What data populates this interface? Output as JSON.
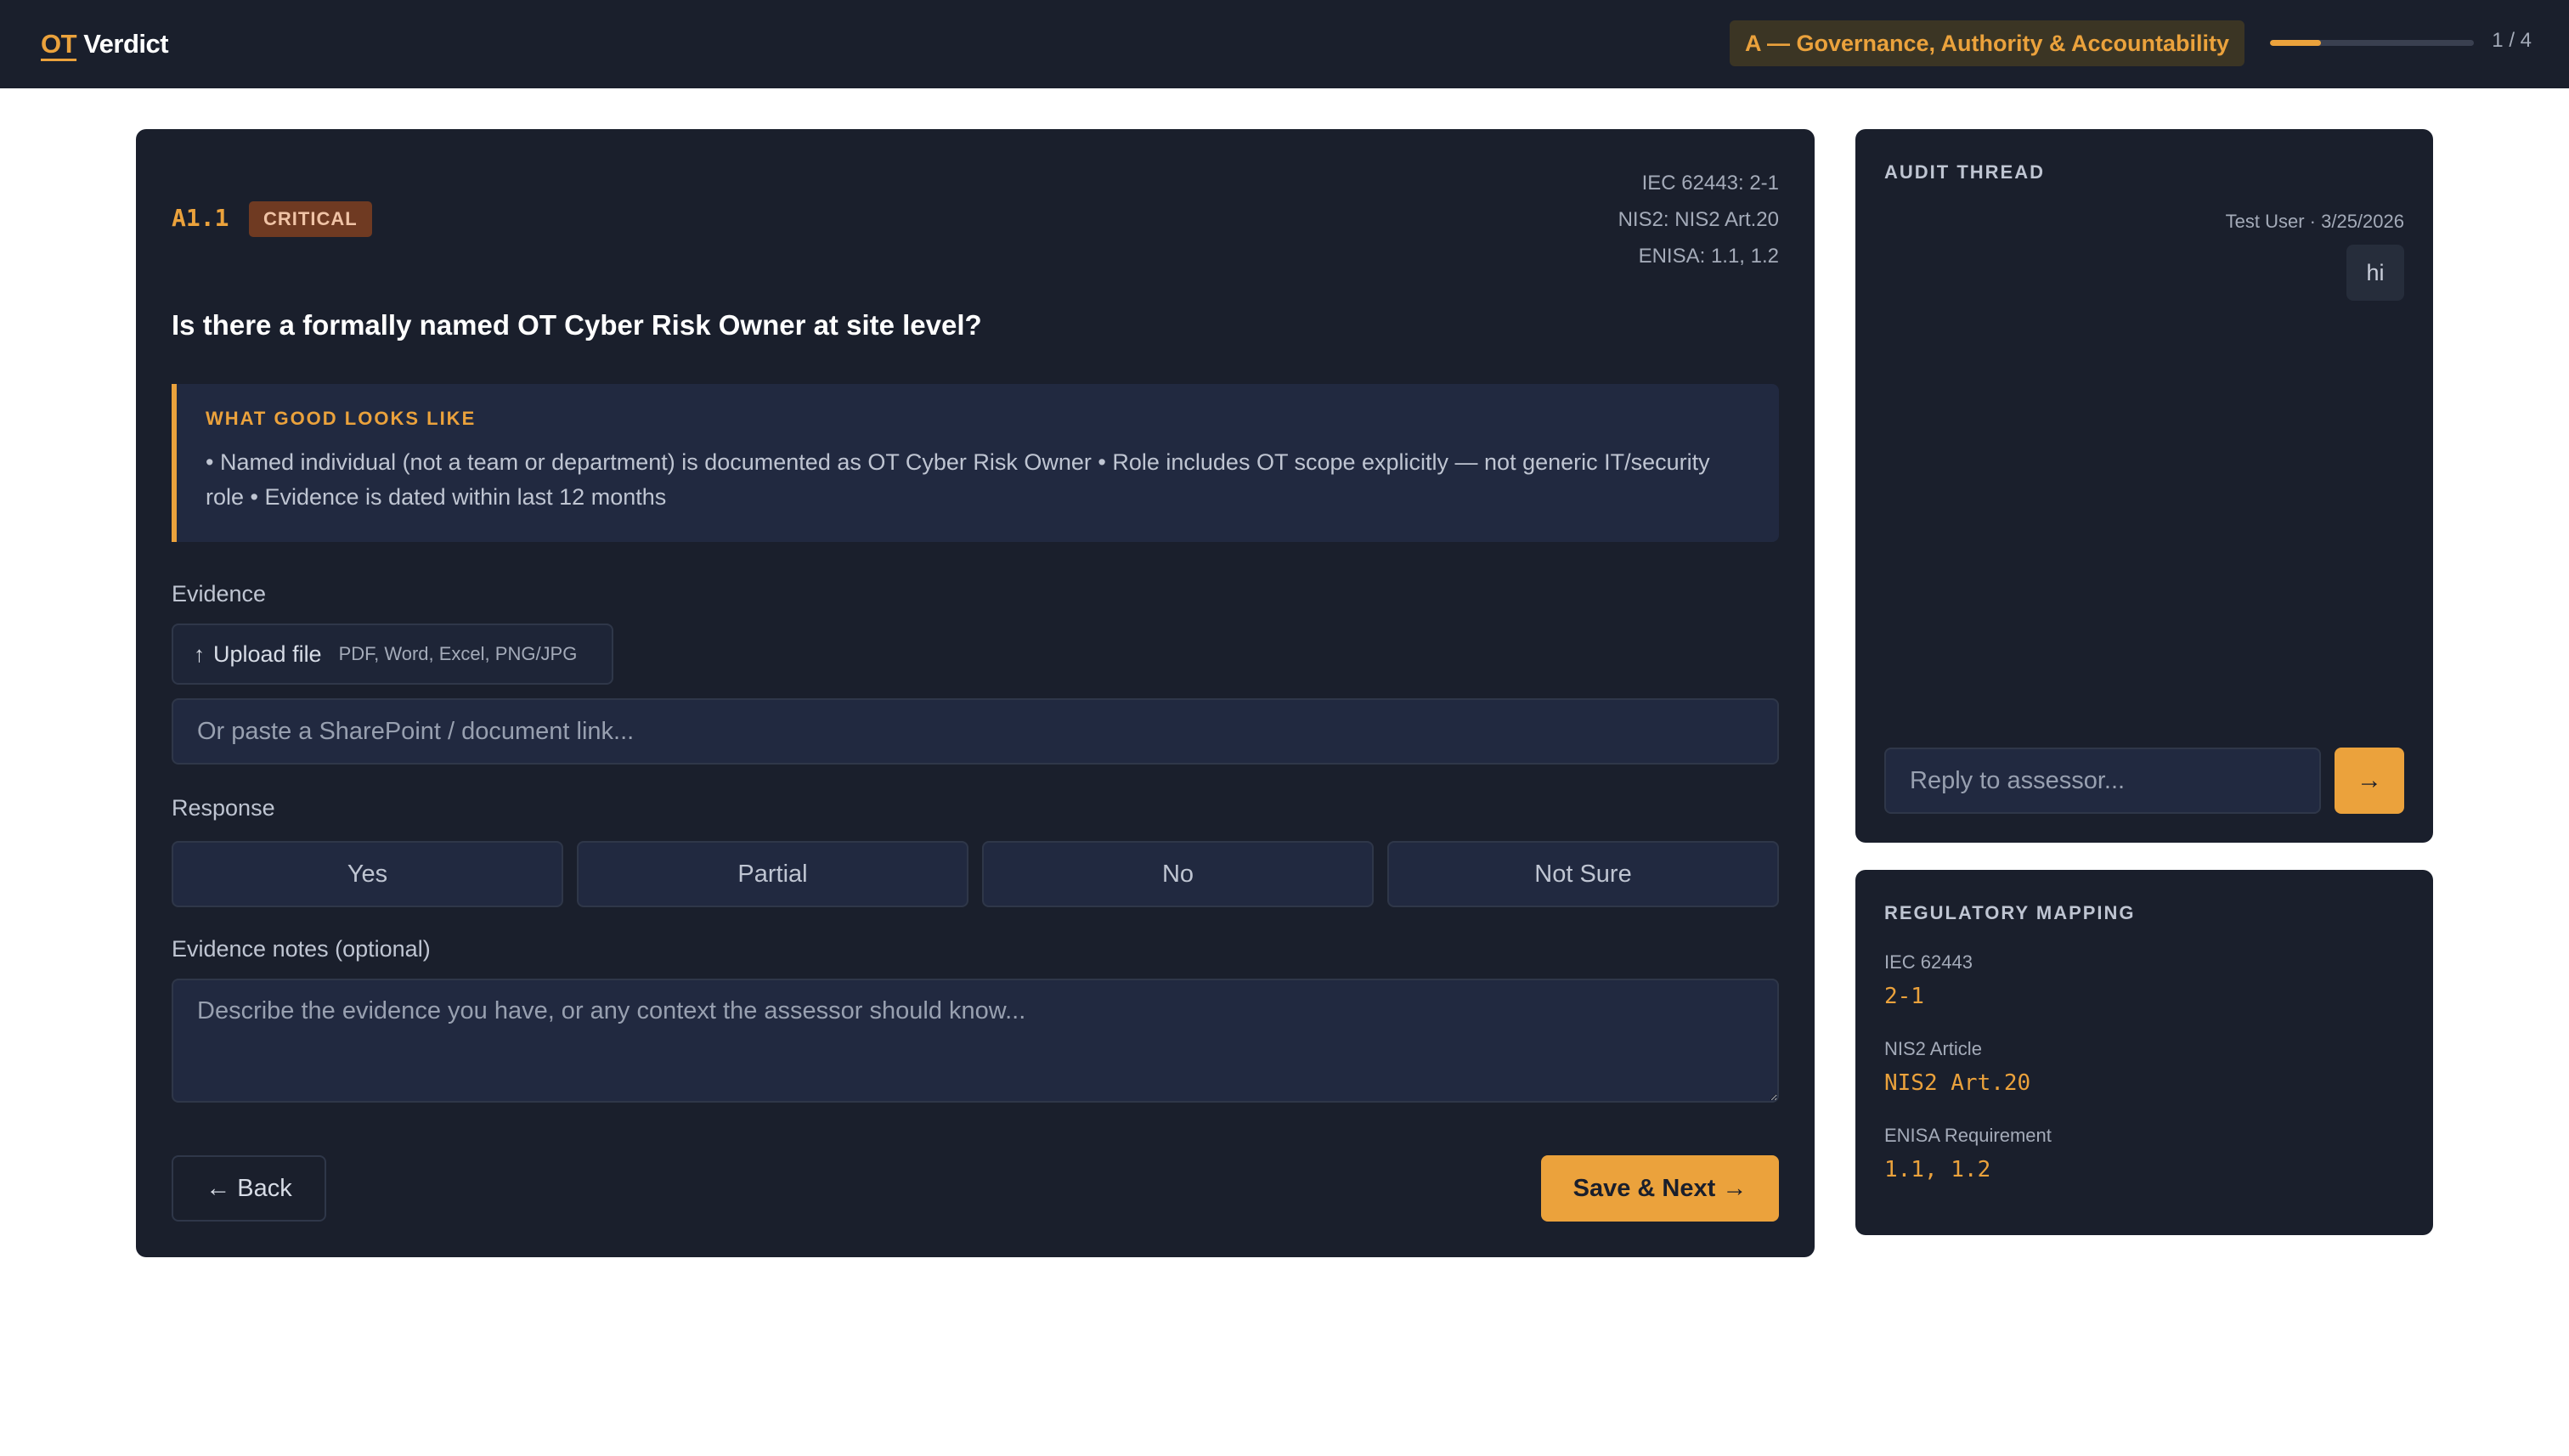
{
  "brand": {
    "accent": "OT",
    "name": "Verdict"
  },
  "header": {
    "section": "A — Governance, Authority & Accountability",
    "progress_fraction": 0.25,
    "progress_text": "1 / 4"
  },
  "question": {
    "id": "A1.1",
    "severity": "CRITICAL",
    "refs": [
      "IEC 62443: 2-1",
      "NIS2: NIS2 Art.20",
      "ENISA: 1.1, 1.2"
    ],
    "text": "Is there a formally named OT Cyber Risk Owner at site level?",
    "good": {
      "title": "WHAT GOOD LOOKS LIKE",
      "body": "• Named individual (not a team or department) is documented as OT Cyber Risk Owner • Role includes OT scope explicitly — not generic IT/security role • Evidence is dated within last 12 months"
    }
  },
  "evidence": {
    "label": "Evidence",
    "upload_label": "Upload file",
    "upload_hint": "PDF, Word, Excel, PNG/JPG",
    "link_placeholder": "Or paste a SharePoint / document link..."
  },
  "response": {
    "label": "Response",
    "options": [
      "Yes",
      "Partial",
      "No",
      "Not Sure"
    ]
  },
  "notes": {
    "label": "Evidence notes (optional)",
    "placeholder": "Describe the evidence you have, or any context the assessor should know..."
  },
  "actions": {
    "back": "← Back",
    "save": "Save & Next →"
  },
  "audit": {
    "title": "AUDIT THREAD",
    "messages": [
      {
        "meta": "Test User · 3/25/2026",
        "text": "hi"
      }
    ],
    "reply_placeholder": "Reply to assessor...",
    "send": "→"
  },
  "regulatory": {
    "title": "REGULATORY MAPPING",
    "items": [
      {
        "label": "IEC 62443",
        "value": "2-1"
      },
      {
        "label": "NIS2 Article",
        "value": "NIS2 Art.20"
      },
      {
        "label": "ENISA Requirement",
        "value": "1.1, 1.2"
      }
    ]
  },
  "colors": {
    "accent": "#eba23c",
    "panel": "#1a1f2c",
    "critical": "#6f3a22"
  }
}
